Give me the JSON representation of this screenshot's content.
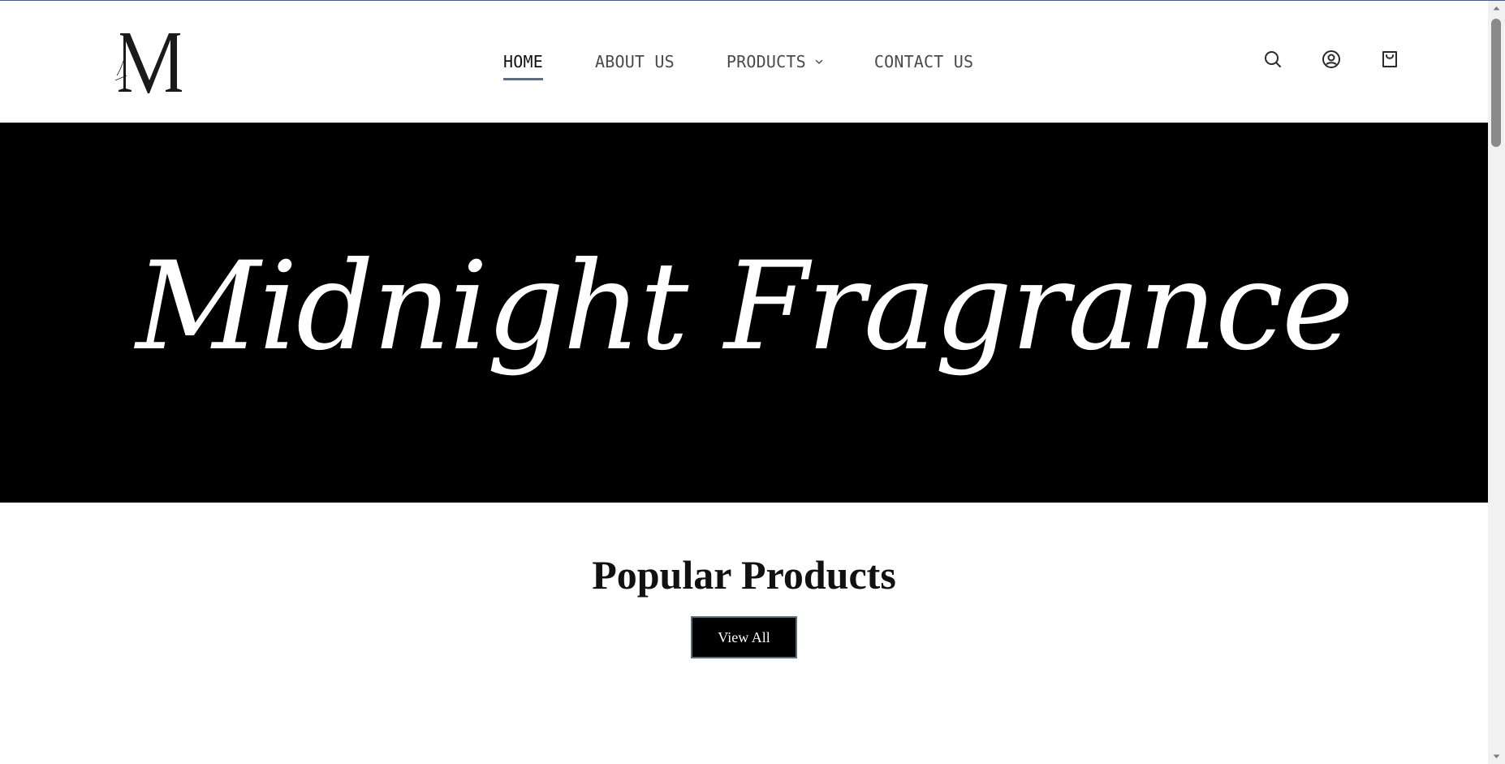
{
  "header": {
    "logo_alt": "M",
    "nav": [
      {
        "label": "HOME",
        "active": true
      },
      {
        "label": "ABOUT US",
        "active": false
      },
      {
        "label": "PRODUCTS",
        "active": false,
        "has_dropdown": true
      },
      {
        "label": "CONTACT US",
        "active": false
      }
    ],
    "icons": [
      "search-icon",
      "account-icon",
      "cart-icon"
    ]
  },
  "hero": {
    "title": "Midnight Fragrance",
    "background": "#000000",
    "text_color": "#ffffff"
  },
  "popular": {
    "title": "Popular Products",
    "button_label": "View All"
  },
  "colors": {
    "nav_active_underline": "#5d6e84",
    "button_border": "#5a6b7e"
  }
}
